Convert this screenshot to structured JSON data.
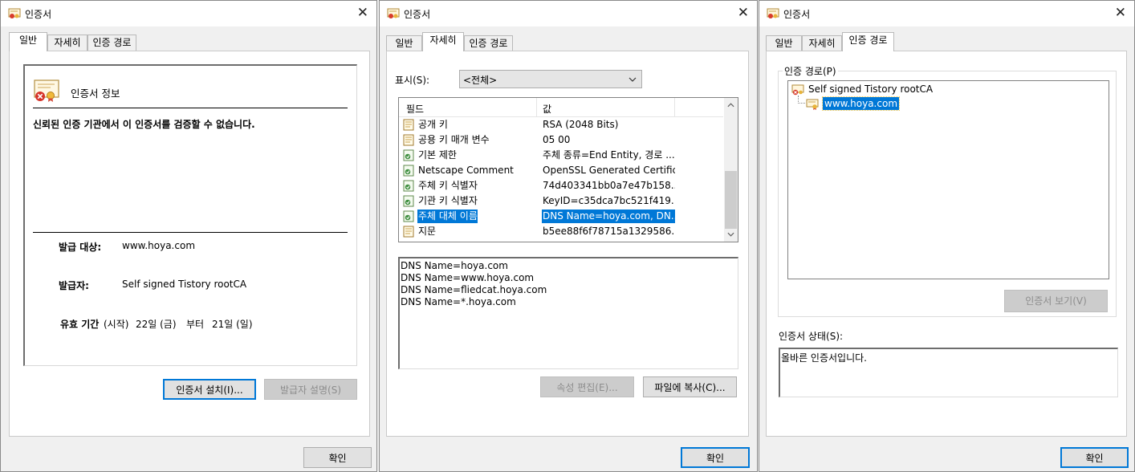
{
  "title": "인증서",
  "tabs": [
    "일반",
    "자세히",
    "인증 경로"
  ],
  "ok_label": "확인",
  "general": {
    "info_title": "인증서 정보",
    "warning": "신뢰된 인증 기관에서 이 인증서를 검증할 수 없습니다.",
    "issued_to_label": "발급 대상:",
    "issued_to_value": "www.hoya.com",
    "issued_by_label": "발급자:",
    "issued_by_value": "Self signed Tistory rootCA",
    "validity_label": "유효 기간",
    "validity_start": "(시작)",
    "validity_from": "22일 (금)",
    "validity_mid": "부터",
    "validity_to": "21일 (일)",
    "install_button": "인증서 설치(I)...",
    "issuer_statement_button": "발급자 설명(S)"
  },
  "details": {
    "show_label": "표시(S):",
    "show_value": "<전체>",
    "col_field": "필드",
    "col_value": "값",
    "rows": [
      {
        "name": "공개 키",
        "value": "RSA (2048 Bits)",
        "icon": "document-icon"
      },
      {
        "name": "공용 키 매개 변수",
        "value": "05 00",
        "icon": "document-icon"
      },
      {
        "name": "기본 제한",
        "value": "주체 종류=End Entity, 경로 ...",
        "icon": "extension-icon"
      },
      {
        "name": "Netscape Comment",
        "value": "OpenSSL Generated Certific...",
        "icon": "extension-icon"
      },
      {
        "name": "주체 키 식별자",
        "value": "74d403341bb0a7e47b158...",
        "icon": "extension-icon"
      },
      {
        "name": "기관 키 식별자",
        "value": "KeyID=c35dca7bc521f419...",
        "icon": "extension-icon"
      },
      {
        "name": "주체 대체 이름",
        "value": "DNS Name=hoya.com, DN...",
        "icon": "extension-icon",
        "selected": true
      },
      {
        "name": "지문",
        "value": "b5ee88f6f78715a1329586...",
        "icon": "document-icon"
      }
    ],
    "value_lines": [
      "DNS Name=hoya.com",
      "DNS Name=www.hoya.com",
      "DNS Name=fliedcat.hoya.com",
      "DNS Name=*.hoya.com"
    ],
    "edit_props_button": "속성 편집(E)...",
    "copy_to_file_button": "파일에 복사(C)..."
  },
  "path": {
    "group_label": "인증 경로(P)",
    "root_node": "Self signed Tistory rootCA",
    "child_node": "www.hoya.com",
    "view_cert_button": "인증서 보기(V)",
    "status_label": "인증서 상태(S):",
    "status_value": "올바른 인증서입니다."
  },
  "colors": {
    "selection": "#0078d7",
    "focus_border": "#0078d7",
    "window_bg": "#f0f0f0"
  }
}
